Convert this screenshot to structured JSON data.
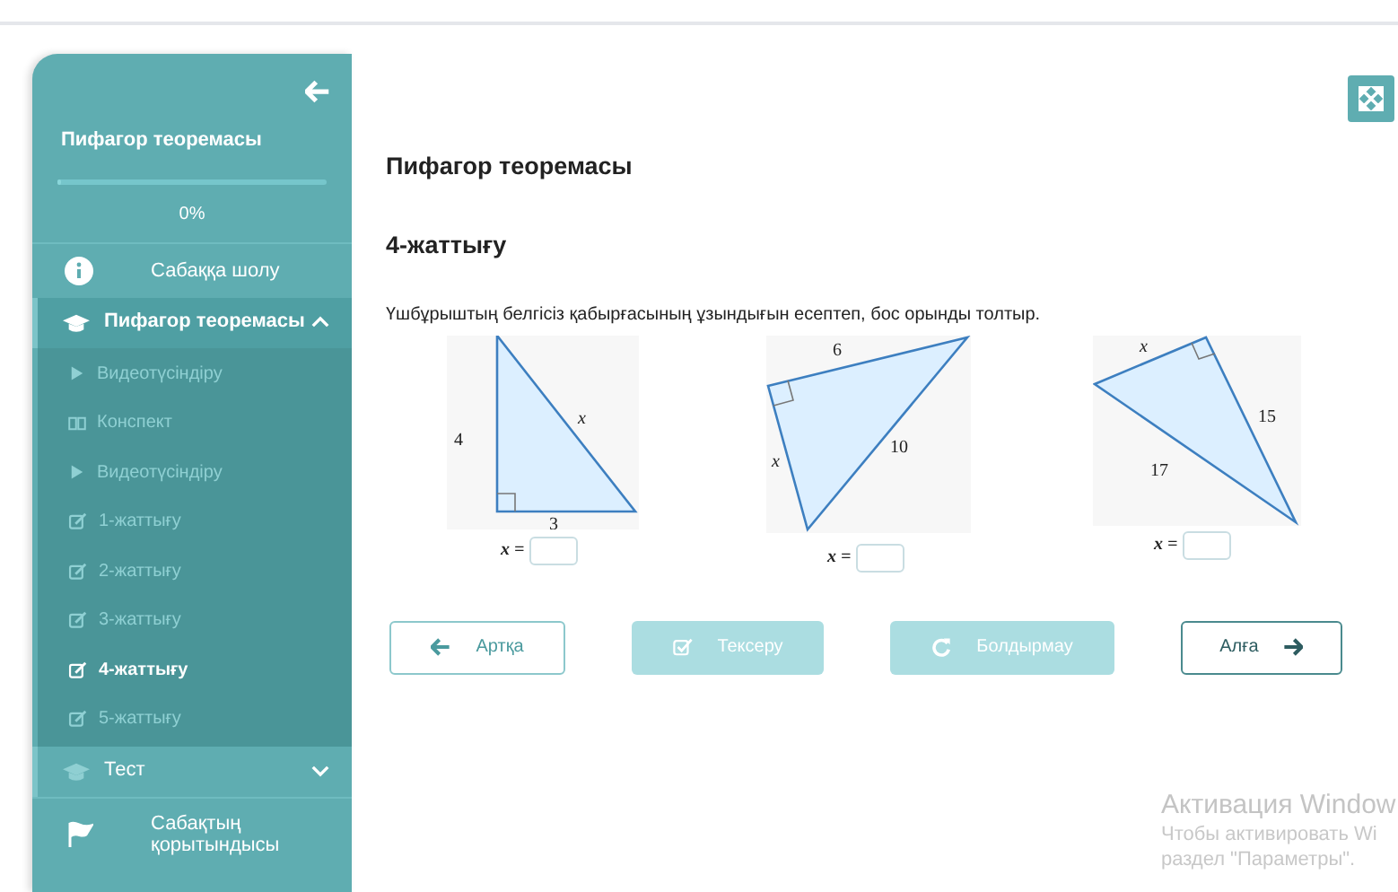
{
  "sidebar": {
    "title": "Пифагор теоремасы",
    "progress": {
      "level": 0,
      "reading": "0%"
    },
    "items": [
      {
        "kind": "overview",
        "label": "Сабаққа шолу"
      },
      {
        "kind": "section",
        "label": "Пифагор теоремасы",
        "expanded": true,
        "children": [
          {
            "kind": "video",
            "label": "Видеотүсіндіру",
            "selected": false
          },
          {
            "kind": "notes",
            "label": "Конспект",
            "selected": false
          },
          {
            "kind": "video",
            "label": "Видеотүсіндіру",
            "selected": false
          },
          {
            "kind": "exercise",
            "label": "1-жаттығу",
            "selected": false
          },
          {
            "kind": "exercise",
            "label": "2-жаттығу",
            "selected": false
          },
          {
            "kind": "exercise",
            "label": "3-жаттығу",
            "selected": false
          },
          {
            "kind": "exercise",
            "label": "4-жаттығу",
            "selected": true
          },
          {
            "kind": "exercise",
            "label": "5-жаттығу",
            "selected": false
          }
        ]
      },
      {
        "kind": "section",
        "label": "Тест",
        "expanded": false
      },
      {
        "kind": "summary",
        "label": "Сабақтың қорытындысы"
      }
    ]
  },
  "main": {
    "lesson_title": "Пифагор теоремасы",
    "exercise_title": "4-жаттығу",
    "instruction": "Үшбұрыштың белгісіз қабырғасының ұзындығын есептеп, бос орынды толтыр.",
    "figures": [
      {
        "labels": [
          "4",
          "x",
          "3"
        ],
        "answer_label": "x ="
      },
      {
        "labels": [
          "6",
          "x",
          "10"
        ],
        "answer_label": "x ="
      },
      {
        "labels": [
          "x",
          "15",
          "17"
        ],
        "answer_label": "x ="
      }
    ],
    "buttons": [
      {
        "kind": "back",
        "label": "Артқа",
        "disabled": false
      },
      {
        "kind": "check",
        "label": "Тексеру",
        "disabled": true
      },
      {
        "kind": "reset",
        "label": "Болдырмау",
        "disabled": true
      },
      {
        "kind": "next",
        "label": "Алға",
        "disabled": false
      }
    ]
  },
  "os_overlay": {
    "title": "Активация Window",
    "lines": [
      "Чтобы активировать Wi",
      "раздел \"Параметры\"."
    ]
  }
}
